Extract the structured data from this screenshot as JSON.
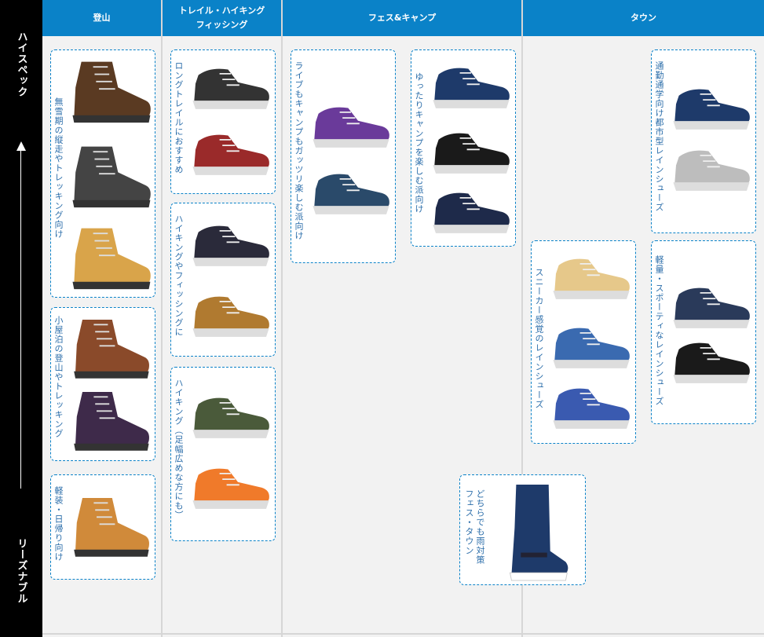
{
  "axis": {
    "top_label": "ハイスペック",
    "bottom_label": "リーズナブル"
  },
  "columns": [
    {
      "id": "mountain",
      "label": "登山"
    },
    {
      "id": "trail",
      "label": "トレイル・ハイキング\nフィッシング"
    },
    {
      "id": "fes",
      "label": "フェス&キャンプ"
    },
    {
      "id": "town",
      "label": "タウン"
    }
  ],
  "cards": [
    {
      "id": "c1",
      "text": "無雪期の縦走やトレッキング向け"
    },
    {
      "id": "c2",
      "text": "小屋泊の登山やトレッキング"
    },
    {
      "id": "c3",
      "text": "軽装・日帰り向け"
    },
    {
      "id": "c4",
      "text": "ロングトレイルにおすすめ"
    },
    {
      "id": "c5",
      "text": "ハイキングやフィッシングに"
    },
    {
      "id": "c6",
      "text": "ハイキング（足幅広めな方にも）"
    },
    {
      "id": "c7",
      "text": "ライブもキャンプもガッツリ楽しむ派向け"
    },
    {
      "id": "c8",
      "text": "ゆったりキャンプを楽しむ派向け"
    },
    {
      "id": "c9",
      "text": "スニーカー感覚のレインシューズ"
    },
    {
      "id": "c10",
      "text": "どちらでも雨対策\nフェス・タウン"
    },
    {
      "id": "c11",
      "text": "通勤通学向け都市型レインシューズ"
    },
    {
      "id": "c12",
      "text": "軽量・スポーティなレインシューズ"
    }
  ],
  "colors": {
    "header": "#0a82c8",
    "card_border": "#0a82c8",
    "card_text": "#2c6eaa",
    "axis_bg": "#000000"
  }
}
